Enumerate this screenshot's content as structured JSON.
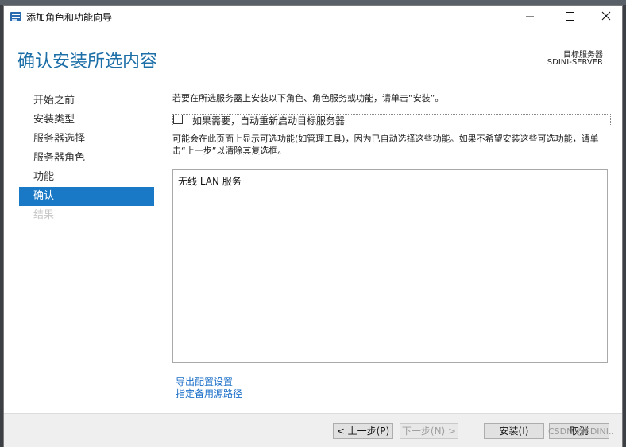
{
  "window": {
    "title": "添加角色和功能向导"
  },
  "header": {
    "page_title": "确认安装所选内容",
    "target_label": "目标服务器",
    "target_name": "SDINI-SERVER"
  },
  "nav": {
    "items": [
      {
        "label": "开始之前",
        "state": "normal"
      },
      {
        "label": "安装类型",
        "state": "normal"
      },
      {
        "label": "服务器选择",
        "state": "normal"
      },
      {
        "label": "服务器角色",
        "state": "normal"
      },
      {
        "label": "功能",
        "state": "normal"
      },
      {
        "label": "确认",
        "state": "active"
      },
      {
        "label": "结果",
        "state": "disabled"
      }
    ]
  },
  "content": {
    "intro": "若要在所选服务器上安装以下角色、角色服务或功能，请单击“安装”。",
    "restart_label": "如果需要，自动重新启动目标服务器",
    "restart_checked": false,
    "notice": "可能会在此页面上显示可选功能(如管理工具)，因为已自动选择这些功能。如果不希望安装这些可选功能，请单击“上一步”以清除其复选框。",
    "features": [
      "无线 LAN 服务"
    ],
    "export_link": "导出配置设置",
    "alt_source_link": "指定备用源路径"
  },
  "footer": {
    "prev_label": "< 上一步(P)",
    "next_label": "下一步(N) >",
    "install_label": "安装(I)",
    "cancel_label": "取消"
  },
  "watermark": "CSDN @SDINI..",
  "colors": {
    "accent": "#1a79c6",
    "title_blue": "#1d6fa8",
    "link": "#1a6ec8"
  }
}
